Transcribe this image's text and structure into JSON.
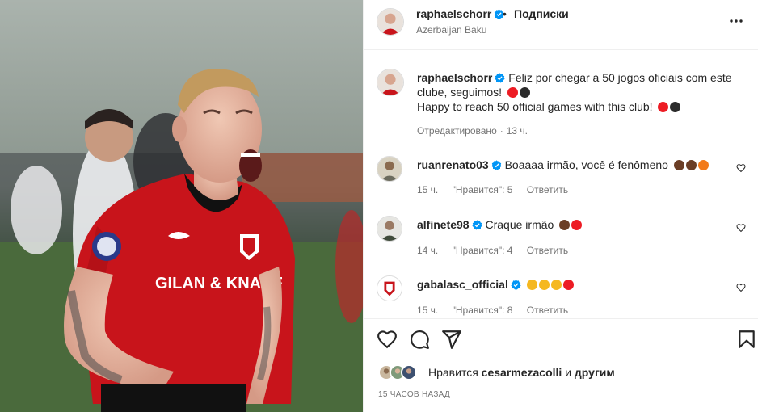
{
  "header": {
    "username": "raphaelschorr",
    "separator": "•",
    "follow_label": "Подписки",
    "location": "Azerbaijan Baku",
    "icons": {
      "verified": "verified-badge-icon",
      "more": "more-options-icon"
    }
  },
  "photo": {
    "sponsor_text": "GILAN & KNAUF",
    "description_icon": "post-photo"
  },
  "caption": {
    "username": "raphaelschorr",
    "line1": "Feliz por chegar a 50 jogos oficiais com este clube, seguimos!",
    "line2": "Happy to reach 50 official games with this club!",
    "edited": "Отредактировано",
    "dot": "·",
    "time": "13 ч."
  },
  "comments": [
    {
      "username": "ruanrenato03",
      "text": "Boaaaa irmão, você é fenômeno",
      "time": "15 ч.",
      "likes": "\"Нравится\": 5",
      "reply": "Ответить"
    },
    {
      "username": "alfinete98",
      "text": "Craque irmão",
      "time": "14 ч.",
      "likes": "\"Нравится\": 4",
      "reply": "Ответить"
    },
    {
      "username": "gabalasc_official",
      "text": "",
      "time": "15 ч.",
      "likes": "\"Нравится\": 8",
      "reply": "Ответить"
    }
  ],
  "likes": {
    "prefix": "Нравится",
    "user": "cesarmezacolli",
    "and": "и",
    "others": "другим"
  },
  "timestamp": "15 ЧАСОВ НАЗАД",
  "colors": {
    "verified": "#0095f6",
    "jersey_red": "#c8141b",
    "text": "#262626",
    "muted": "#737373",
    "heart_red": "#ed1c24"
  }
}
